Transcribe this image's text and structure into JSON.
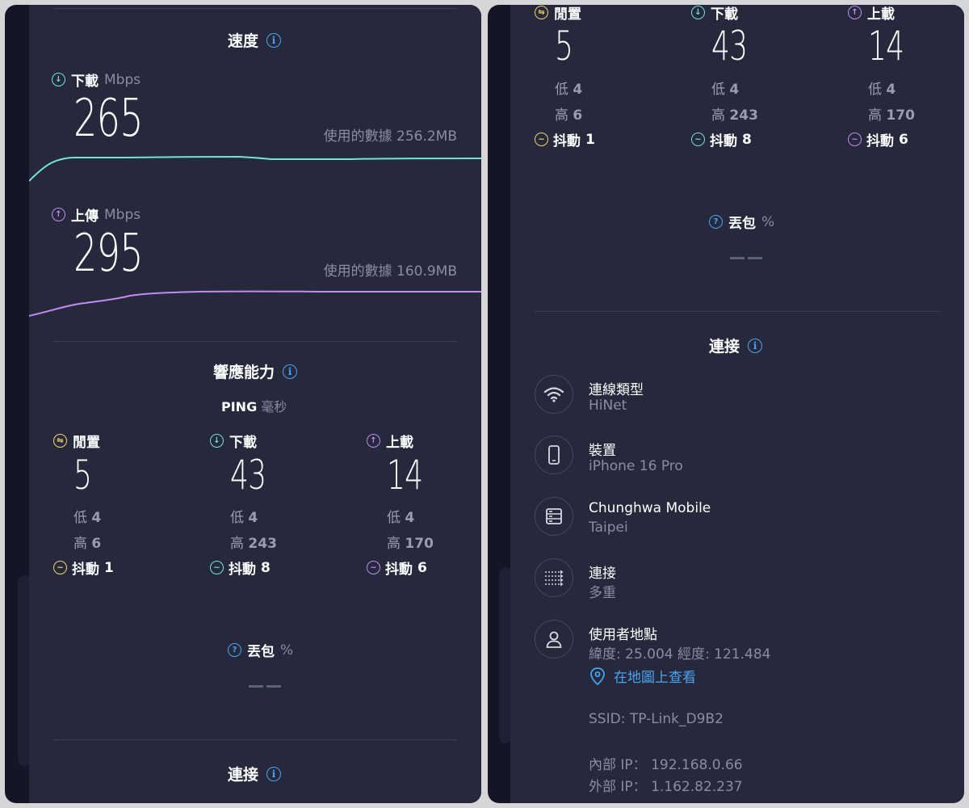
{
  "left": {
    "speed": {
      "title": "速度",
      "download": {
        "label": "下載",
        "unit": "Mbps",
        "value": "265",
        "data_used": "使用的數據 256.2MB"
      },
      "upload": {
        "label": "上傳",
        "unit": "Mbps",
        "value": "295",
        "data_used": "使用的數據 160.9MB"
      }
    },
    "responsiveness": {
      "title": "響應能力",
      "ping_label": "PING",
      "ping_unit": "毫秒",
      "columns": [
        {
          "label": "閒置",
          "value": "5",
          "low_label": "低",
          "low": "4",
          "high_label": "高",
          "high": "6",
          "jitter_label": "抖動",
          "jitter": "1"
        },
        {
          "label": "下載",
          "value": "43",
          "low_label": "低",
          "low": "4",
          "high_label": "高",
          "high": "243",
          "jitter_label": "抖動",
          "jitter": "8"
        },
        {
          "label": "上載",
          "value": "14",
          "low_label": "低",
          "low": "4",
          "high_label": "高",
          "high": "170",
          "jitter_label": "抖動",
          "jitter": "6"
        }
      ],
      "packet_loss": {
        "label": "丟包",
        "unit": "%"
      }
    },
    "connection_title": "連接"
  },
  "right": {
    "columns": [
      {
        "label": "閒置",
        "value": "5",
        "low_label": "低",
        "low": "4",
        "high_label": "高",
        "high": "6",
        "jitter_label": "抖動",
        "jitter": "1"
      },
      {
        "label": "下載",
        "value": "43",
        "low_label": "低",
        "low": "4",
        "high_label": "高",
        "high": "243",
        "jitter_label": "抖動",
        "jitter": "8"
      },
      {
        "label": "上載",
        "value": "14",
        "low_label": "低",
        "low": "4",
        "high_label": "高",
        "high": "170",
        "jitter_label": "抖動",
        "jitter": "6"
      }
    ],
    "packet_loss": {
      "label": "丟包",
      "unit": "%"
    },
    "connection": {
      "title": "連接",
      "items": [
        {
          "icon": "wifi-icon",
          "title": "連線類型",
          "subtitle": "HiNet"
        },
        {
          "icon": "phone-icon",
          "title": "裝置",
          "subtitle": "iPhone 16 Pro"
        },
        {
          "icon": "server-icon",
          "title": "Chunghwa Mobile",
          "subtitle": "Taipei"
        },
        {
          "icon": "multi-connection-icon",
          "title": "連接",
          "subtitle": "多重"
        },
        {
          "icon": "user-icon",
          "title": "使用者地點",
          "subtitle": "緯度: 25.004  經度: 121.484"
        }
      ],
      "map_link": "在地圖上查看",
      "ssid": "SSID: TP-Link_D9B2",
      "internal_ip": "內部 IP： 192.168.0.66",
      "external_ip": "外部 IP： 1.162.82.237"
    }
  },
  "colors": {
    "background": "#141526",
    "surface": "#26283c",
    "download_line": "#6fe3d8",
    "upload_line": "#c58af2",
    "idle": "#f2d36b",
    "info": "#4aa3f0"
  }
}
